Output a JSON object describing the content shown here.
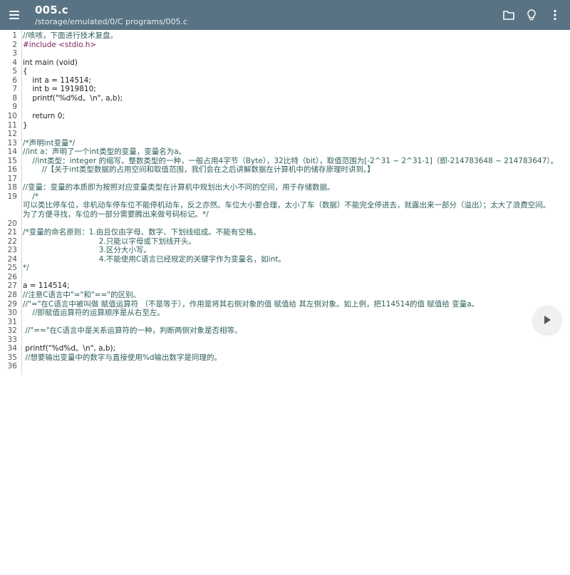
{
  "appbar": {
    "title": "005.c",
    "path": "/storage/emulated/0/C programs/005.c",
    "icons": [
      "menu-icon",
      "folder-icon",
      "lightbulb-icon",
      "more-vert-icon"
    ]
  },
  "editor": {
    "line_numbers": [
      "1",
      "2",
      "3",
      "4",
      "5",
      "6",
      "7",
      "8",
      "9",
      "10",
      "11",
      "12",
      "13",
      "14",
      "15",
      "16",
      "17",
      "18",
      "19",
      "",
      "",
      "20",
      "21",
      "22",
      "23",
      "24",
      "25",
      "26",
      "27",
      "28",
      "29",
      "30",
      "31",
      "32",
      "33",
      "34",
      "35",
      "36"
    ],
    "lines": [
      {
        "text": "//咳咳，下面进行技术复盘。",
        "kind": "comment"
      },
      {
        "text": "#include <stdio.h>",
        "kind": "pre"
      },
      {
        "text": "",
        "kind": "text"
      },
      {
        "text": "int main (void)",
        "kind": "text"
      },
      {
        "text": "{",
        "kind": "text"
      },
      {
        "text": "    int a = 114514;",
        "kind": "text"
      },
      {
        "text": "    int b = 1919810;",
        "kind": "text"
      },
      {
        "text": "    printf(\"%d%d。\\n\", a,b);",
        "kind": "text"
      },
      {
        "text": "",
        "kind": "text"
      },
      {
        "text": "    return 0;",
        "kind": "text"
      },
      {
        "text": "}",
        "kind": "text"
      },
      {
        "text": "",
        "kind": "text"
      },
      {
        "text": "/*声明int变量*/",
        "kind": "comment"
      },
      {
        "text": "//int a：声明了一个int类型的变量，变量名为a。",
        "kind": "comment"
      },
      {
        "text": "    //int类型：integer 的缩写。整数类型的一种，一般占用4字节（Byte），32比特（bit），取值范围为[-2^31 ~ 2^31-1]（即-214783648 ~ 214783647）。",
        "kind": "comment"
      },
      {
        "text": "        //【关于int类型数据的占用空间和取值范围，我们会在之后讲解数据在计算机中的储存原理时讲到。】",
        "kind": "comment"
      },
      {
        "text": "",
        "kind": "text"
      },
      {
        "text": "//变量：变量的本质即为按照对应变量类型在计算机中规划出大小不同的空间，用于存储数据。",
        "kind": "comment"
      },
      {
        "text": "    /*",
        "kind": "comment"
      },
      {
        "text": "可以类比停车位，非机动车停车位不能停机动车，反之亦然。车位大小要合理，太小了车（数据）不能完全停进去，就露出来一部分（溢出）；太大了浪费空间。",
        "kind": "comment"
      },
      {
        "text": "为了方便寻找，车位的一部分需要腾出来做号码标记。*/",
        "kind": "comment"
      },
      {
        "text": "",
        "kind": "text"
      },
      {
        "text": "/*变量的命名原则：1.由且仅由字母、数字、下划线组成。不能有空格。",
        "kind": "comment"
      },
      {
        "text": "                                2.只能以字母或下划线开头。",
        "kind": "comment"
      },
      {
        "text": "                                3.区分大小写。",
        "kind": "comment"
      },
      {
        "text": "                                4.不能使用C语言已经规定的关键字作为变量名，如int。",
        "kind": "comment"
      },
      {
        "text": "*/",
        "kind": "comment"
      },
      {
        "text": "",
        "kind": "text"
      },
      {
        "text": "a = 114514;",
        "kind": "text"
      },
      {
        "text": "//注意C语言中\"=\"和\"==\"的区别。",
        "kind": "comment"
      },
      {
        "text": "//\"=\"在C语言中被叫做 赋值运算符 （不是等于），作用是将其右侧对象的值 赋值给 其左侧对象。如上例，把114514的值 赋值给 变量a。",
        "kind": "comment"
      },
      {
        "text": "    //即赋值运算符的运算顺序是从右至左。",
        "kind": "comment"
      },
      {
        "text": "",
        "kind": "text"
      },
      {
        "text": " //\"==\"在C语言中是关系运算符的一种，判断两侧对象是否相等。",
        "kind": "comment"
      },
      {
        "text": "",
        "kind": "text"
      },
      {
        "text": " printf(\"%d%d。\\n\", a,b);",
        "kind": "text"
      },
      {
        "text": " //想要输出变量中的数字与直接使用%d输出数字是同理的。",
        "kind": "comment"
      },
      {
        "text": "",
        "kind": "text"
      }
    ]
  }
}
